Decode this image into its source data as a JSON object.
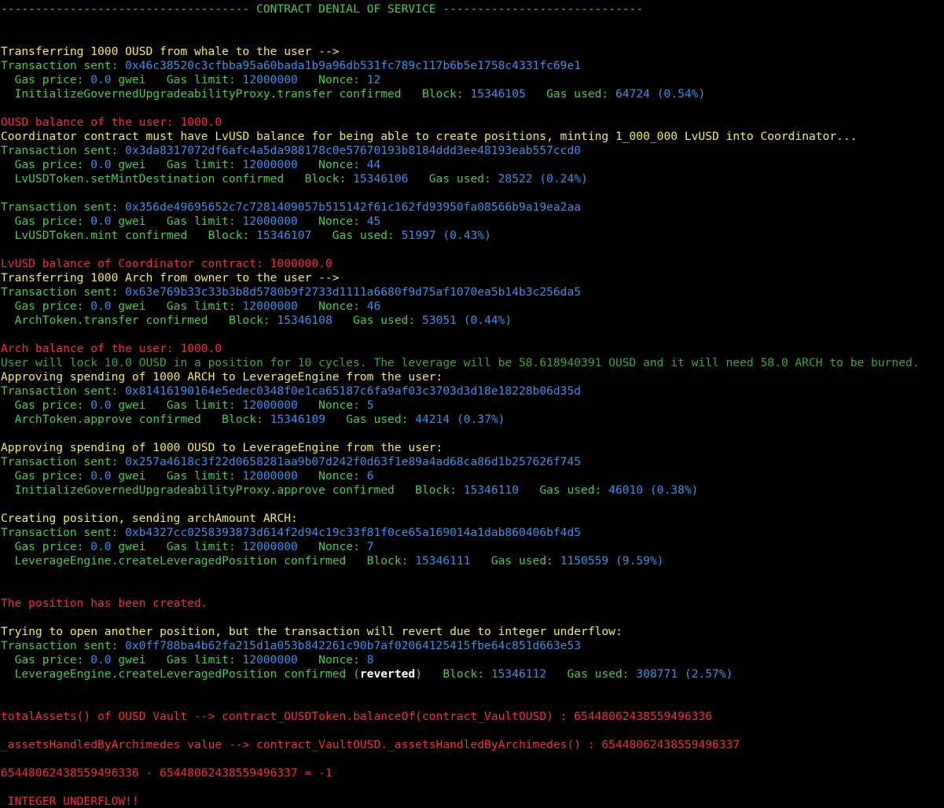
{
  "colors": {
    "background": "#000000",
    "green": "#4ec94e",
    "yellow": "#f5e960",
    "red": "#f0313a",
    "blue": "#3d8fe8",
    "white": "#ffffff"
  },
  "banner": "------------------------------------ CONTRACT DENIAL OF SERVICE -----------------------------",
  "labels": {
    "tx_sent": "Transaction sent: ",
    "gas_price": "  Gas price: ",
    "gwei": " gwei   Gas limit: ",
    "nonce": "   Nonce: ",
    "block": "   Block: ",
    "gas_used": "   Gas used: "
  },
  "lines": {
    "transfer_ousd_msg": "Transferring 1000 OUSD from whale to the user -->",
    "tx1_hash": "0x46c38520c3cfbba95a60bada1b9a96db531fc789c117b6b5e1758c4331fc69e1",
    "tx1_gas_price": "0.0",
    "tx1_gas_limit": "12000000",
    "tx1_nonce": "12",
    "tx1_name": "  InitializeGovernedUpgradeabilityProxy.transfer confirmed",
    "tx1_block": "15346105",
    "tx1_gas_used": "64724",
    "tx1_pct": "(0.54%)",
    "ousd_balance": "OUSD balance of the user: 1000.0",
    "coordinator_msg": "Coordinator contract must have LvUSD balance for being able to create positions, minting 1_000_000 LvUSD into Coordinator...",
    "tx2_hash": "0x3da8317072df6afc4a5da988178c0e57670193b8184ddd3ee48193eab557ccd0",
    "tx2_gas_price": "0.0",
    "tx2_gas_limit": "12000000",
    "tx2_nonce": "44",
    "tx2_name": "  LvUSDToken.setMintDestination confirmed",
    "tx2_block": "15346106",
    "tx2_gas_used": "28522",
    "tx2_pct": "(0.24%)",
    "tx3_hash": "0x356de49695652c7c7281409057b515142f61c162fd93950fa08566b9a19ea2aa",
    "tx3_gas_price": "0.0",
    "tx3_gas_limit": "12000000",
    "tx3_nonce": "45",
    "tx3_name": "  LvUSDToken.mint confirmed",
    "tx3_block": "15346107",
    "tx3_gas_used": "51997",
    "tx3_pct": "(0.43%)",
    "lvusd_balance": "LvUSD balance of Coordinator contract: 1000000.0",
    "transfer_arch_msg": "Transferring 1000 Arch from owner to the user -->",
    "tx4_hash": "0x63e769b33c33b3b8d5780b9f2733d1111a6680f9d75af1070ea5b14b3c256da5",
    "tx4_gas_price": "0.0",
    "tx4_gas_limit": "12000000",
    "tx4_nonce": "46",
    "tx4_name": "  ArchToken.transfer confirmed",
    "tx4_block": "15346108",
    "tx4_gas_used": "53051",
    "tx4_pct": "(0.44%)",
    "arch_balance": "Arch balance of the user: 1000.0",
    "lock_msg": "User will lock 10.0 OUSD in a position for 10 cycles. The leverage will be 58.618940391 OUSD and it will need 58.0 ARCH to be burned.",
    "approve_arch_msg": "Approving spending of 1000 ARCH to LeverageEngine from the user:",
    "tx5_hash": "0x81416190164e5edec0348f0e1ca65187c6fa9af03c3703d3d18e18228b06d35d",
    "tx5_gas_price": "0.0",
    "tx5_gas_limit": "12000000",
    "tx5_nonce": "5",
    "tx5_name": "  ArchToken.approve confirmed",
    "tx5_block": "15346109",
    "tx5_gas_used": "44214",
    "tx5_pct": "(0.37%)",
    "approve_ousd_msg": "Approving spending of 1000 OUSD to LeverageEngine from the user:",
    "tx6_hash": "0x257a4618c3f22d0658281aa9b07d242f0d63f1e89a4ad68ca86d1b257626f745",
    "tx6_gas_price": "0.0",
    "tx6_gas_limit": "12000000",
    "tx6_nonce": "6",
    "tx6_name": "  InitializeGovernedUpgradeabilityProxy.approve confirmed",
    "tx6_block": "15346110",
    "tx6_gas_used": "46010",
    "tx6_pct": "(0.38%)",
    "creating_msg": "Creating position, sending archAmount ARCH:",
    "tx7_hash": "0xb4327cc0258393873d614f2d94c19c33f81f0ce65a169014a1dab860406bf4d5",
    "tx7_gas_price": "0.0",
    "tx7_gas_limit": "12000000",
    "tx7_nonce": "7",
    "tx7_name": "  LeverageEngine.createLeveragedPosition confirmed",
    "tx7_block": "15346111",
    "tx7_gas_used": "1150559",
    "tx7_pct": "(9.59%)",
    "created_msg": "The position has been created.",
    "trying_msg": "Trying to open another position, but the transaction will revert due to integer underflow:",
    "tx8_hash": "0x0ff788ba4b62fa215d1a053b842261c90b7af02064125415fbe64c851d663e53",
    "tx8_gas_price": "0.0",
    "tx8_gas_limit": "12000000",
    "tx8_nonce": "8",
    "tx8_name": "  LeverageEngine.createLeveragedPosition confirmed (",
    "tx8_reverted": "reverted",
    "tx8_close": ")",
    "tx8_block": "15346112",
    "tx8_gas_used": "308771",
    "tx8_pct": "(2.57%)",
    "total_assets": "totalAssets() of OUSD Vault --> contract_OUSDToken.balanceOf(contract_VaultOUSD) : 65448062438559496336",
    "assets_handled": "_assetsHandledByArchimedes value --> contract_VaultOUSD._assetsHandledByArchimedes() : 65448062438559496337",
    "subtraction": "65448062438559496336 - 65448062438559496337 = -1",
    "underflow": " INTEGER UNDERFLOW!!"
  }
}
